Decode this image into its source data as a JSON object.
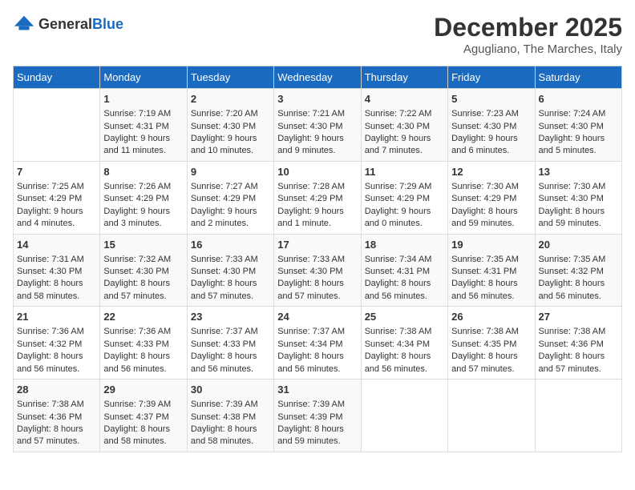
{
  "header": {
    "logo_general": "General",
    "logo_blue": "Blue",
    "month": "December 2025",
    "location": "Agugliano, The Marches, Italy"
  },
  "days_of_week": [
    "Sunday",
    "Monday",
    "Tuesday",
    "Wednesday",
    "Thursday",
    "Friday",
    "Saturday"
  ],
  "weeks": [
    [
      {
        "day": "",
        "sunrise": "",
        "sunset": "",
        "daylight": ""
      },
      {
        "day": "1",
        "sunrise": "Sunrise: 7:19 AM",
        "sunset": "Sunset: 4:31 PM",
        "daylight": "Daylight: 9 hours and 11 minutes."
      },
      {
        "day": "2",
        "sunrise": "Sunrise: 7:20 AM",
        "sunset": "Sunset: 4:30 PM",
        "daylight": "Daylight: 9 hours and 10 minutes."
      },
      {
        "day": "3",
        "sunrise": "Sunrise: 7:21 AM",
        "sunset": "Sunset: 4:30 PM",
        "daylight": "Daylight: 9 hours and 9 minutes."
      },
      {
        "day": "4",
        "sunrise": "Sunrise: 7:22 AM",
        "sunset": "Sunset: 4:30 PM",
        "daylight": "Daylight: 9 hours and 7 minutes."
      },
      {
        "day": "5",
        "sunrise": "Sunrise: 7:23 AM",
        "sunset": "Sunset: 4:30 PM",
        "daylight": "Daylight: 9 hours and 6 minutes."
      },
      {
        "day": "6",
        "sunrise": "Sunrise: 7:24 AM",
        "sunset": "Sunset: 4:30 PM",
        "daylight": "Daylight: 9 hours and 5 minutes."
      }
    ],
    [
      {
        "day": "7",
        "sunrise": "Sunrise: 7:25 AM",
        "sunset": "Sunset: 4:29 PM",
        "daylight": "Daylight: 9 hours and 4 minutes."
      },
      {
        "day": "8",
        "sunrise": "Sunrise: 7:26 AM",
        "sunset": "Sunset: 4:29 PM",
        "daylight": "Daylight: 9 hours and 3 minutes."
      },
      {
        "day": "9",
        "sunrise": "Sunrise: 7:27 AM",
        "sunset": "Sunset: 4:29 PM",
        "daylight": "Daylight: 9 hours and 2 minutes."
      },
      {
        "day": "10",
        "sunrise": "Sunrise: 7:28 AM",
        "sunset": "Sunset: 4:29 PM",
        "daylight": "Daylight: 9 hours and 1 minute."
      },
      {
        "day": "11",
        "sunrise": "Sunrise: 7:29 AM",
        "sunset": "Sunset: 4:29 PM",
        "daylight": "Daylight: 9 hours and 0 minutes."
      },
      {
        "day": "12",
        "sunrise": "Sunrise: 7:30 AM",
        "sunset": "Sunset: 4:29 PM",
        "daylight": "Daylight: 8 hours and 59 minutes."
      },
      {
        "day": "13",
        "sunrise": "Sunrise: 7:30 AM",
        "sunset": "Sunset: 4:30 PM",
        "daylight": "Daylight: 8 hours and 59 minutes."
      }
    ],
    [
      {
        "day": "14",
        "sunrise": "Sunrise: 7:31 AM",
        "sunset": "Sunset: 4:30 PM",
        "daylight": "Daylight: 8 hours and 58 minutes."
      },
      {
        "day": "15",
        "sunrise": "Sunrise: 7:32 AM",
        "sunset": "Sunset: 4:30 PM",
        "daylight": "Daylight: 8 hours and 57 minutes."
      },
      {
        "day": "16",
        "sunrise": "Sunrise: 7:33 AM",
        "sunset": "Sunset: 4:30 PM",
        "daylight": "Daylight: 8 hours and 57 minutes."
      },
      {
        "day": "17",
        "sunrise": "Sunrise: 7:33 AM",
        "sunset": "Sunset: 4:30 PM",
        "daylight": "Daylight: 8 hours and 57 minutes."
      },
      {
        "day": "18",
        "sunrise": "Sunrise: 7:34 AM",
        "sunset": "Sunset: 4:31 PM",
        "daylight": "Daylight: 8 hours and 56 minutes."
      },
      {
        "day": "19",
        "sunrise": "Sunrise: 7:35 AM",
        "sunset": "Sunset: 4:31 PM",
        "daylight": "Daylight: 8 hours and 56 minutes."
      },
      {
        "day": "20",
        "sunrise": "Sunrise: 7:35 AM",
        "sunset": "Sunset: 4:32 PM",
        "daylight": "Daylight: 8 hours and 56 minutes."
      }
    ],
    [
      {
        "day": "21",
        "sunrise": "Sunrise: 7:36 AM",
        "sunset": "Sunset: 4:32 PM",
        "daylight": "Daylight: 8 hours and 56 minutes."
      },
      {
        "day": "22",
        "sunrise": "Sunrise: 7:36 AM",
        "sunset": "Sunset: 4:33 PM",
        "daylight": "Daylight: 8 hours and 56 minutes."
      },
      {
        "day": "23",
        "sunrise": "Sunrise: 7:37 AM",
        "sunset": "Sunset: 4:33 PM",
        "daylight": "Daylight: 8 hours and 56 minutes."
      },
      {
        "day": "24",
        "sunrise": "Sunrise: 7:37 AM",
        "sunset": "Sunset: 4:34 PM",
        "daylight": "Daylight: 8 hours and 56 minutes."
      },
      {
        "day": "25",
        "sunrise": "Sunrise: 7:38 AM",
        "sunset": "Sunset: 4:34 PM",
        "daylight": "Daylight: 8 hours and 56 minutes."
      },
      {
        "day": "26",
        "sunrise": "Sunrise: 7:38 AM",
        "sunset": "Sunset: 4:35 PM",
        "daylight": "Daylight: 8 hours and 57 minutes."
      },
      {
        "day": "27",
        "sunrise": "Sunrise: 7:38 AM",
        "sunset": "Sunset: 4:36 PM",
        "daylight": "Daylight: 8 hours and 57 minutes."
      }
    ],
    [
      {
        "day": "28",
        "sunrise": "Sunrise: 7:38 AM",
        "sunset": "Sunset: 4:36 PM",
        "daylight": "Daylight: 8 hours and 57 minutes."
      },
      {
        "day": "29",
        "sunrise": "Sunrise: 7:39 AM",
        "sunset": "Sunset: 4:37 PM",
        "daylight": "Daylight: 8 hours and 58 minutes."
      },
      {
        "day": "30",
        "sunrise": "Sunrise: 7:39 AM",
        "sunset": "Sunset: 4:38 PM",
        "daylight": "Daylight: 8 hours and 58 minutes."
      },
      {
        "day": "31",
        "sunrise": "Sunrise: 7:39 AM",
        "sunset": "Sunset: 4:39 PM",
        "daylight": "Daylight: 8 hours and 59 minutes."
      },
      {
        "day": "",
        "sunrise": "",
        "sunset": "",
        "daylight": ""
      },
      {
        "day": "",
        "sunrise": "",
        "sunset": "",
        "daylight": ""
      },
      {
        "day": "",
        "sunrise": "",
        "sunset": "",
        "daylight": ""
      }
    ]
  ]
}
